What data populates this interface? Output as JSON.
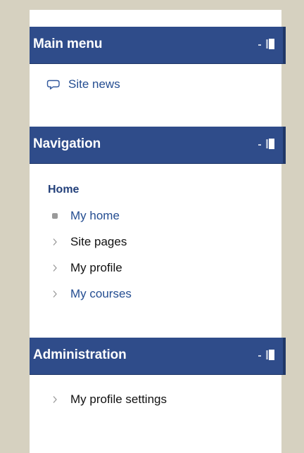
{
  "blocks": {
    "main_menu": {
      "title": "Main menu",
      "items": [
        {
          "label": "Site news",
          "icon": "speech-bubble-icon"
        }
      ],
      "controls": {
        "hide_icon": "minus-icon",
        "dock_icon": "dock-icon"
      }
    },
    "navigation": {
      "title": "Navigation",
      "home": "Home",
      "items": [
        {
          "label": "My home",
          "icon": "square-bullet-icon"
        },
        {
          "label": "Site pages",
          "icon": "chevron-right-icon"
        },
        {
          "label": "My profile",
          "icon": "chevron-right-icon"
        },
        {
          "label": "My courses",
          "icon": "chevron-right-icon"
        }
      ],
      "controls": {
        "hide_icon": "minus-icon",
        "dock_icon": "dock-icon"
      }
    },
    "administration": {
      "title": "Administration",
      "items": [
        {
          "label": "My profile settings",
          "icon": "chevron-right-icon"
        }
      ],
      "controls": {
        "hide_icon": "minus-icon",
        "dock_icon": "dock-icon"
      }
    }
  },
  "colors": {
    "page_background": "#d6d1c0",
    "panel_background": "#ffffff",
    "header_background": "#2f4c8a",
    "header_shadow": "#203767",
    "link_blue": "#244d91",
    "dark_blue": "#23407a"
  }
}
